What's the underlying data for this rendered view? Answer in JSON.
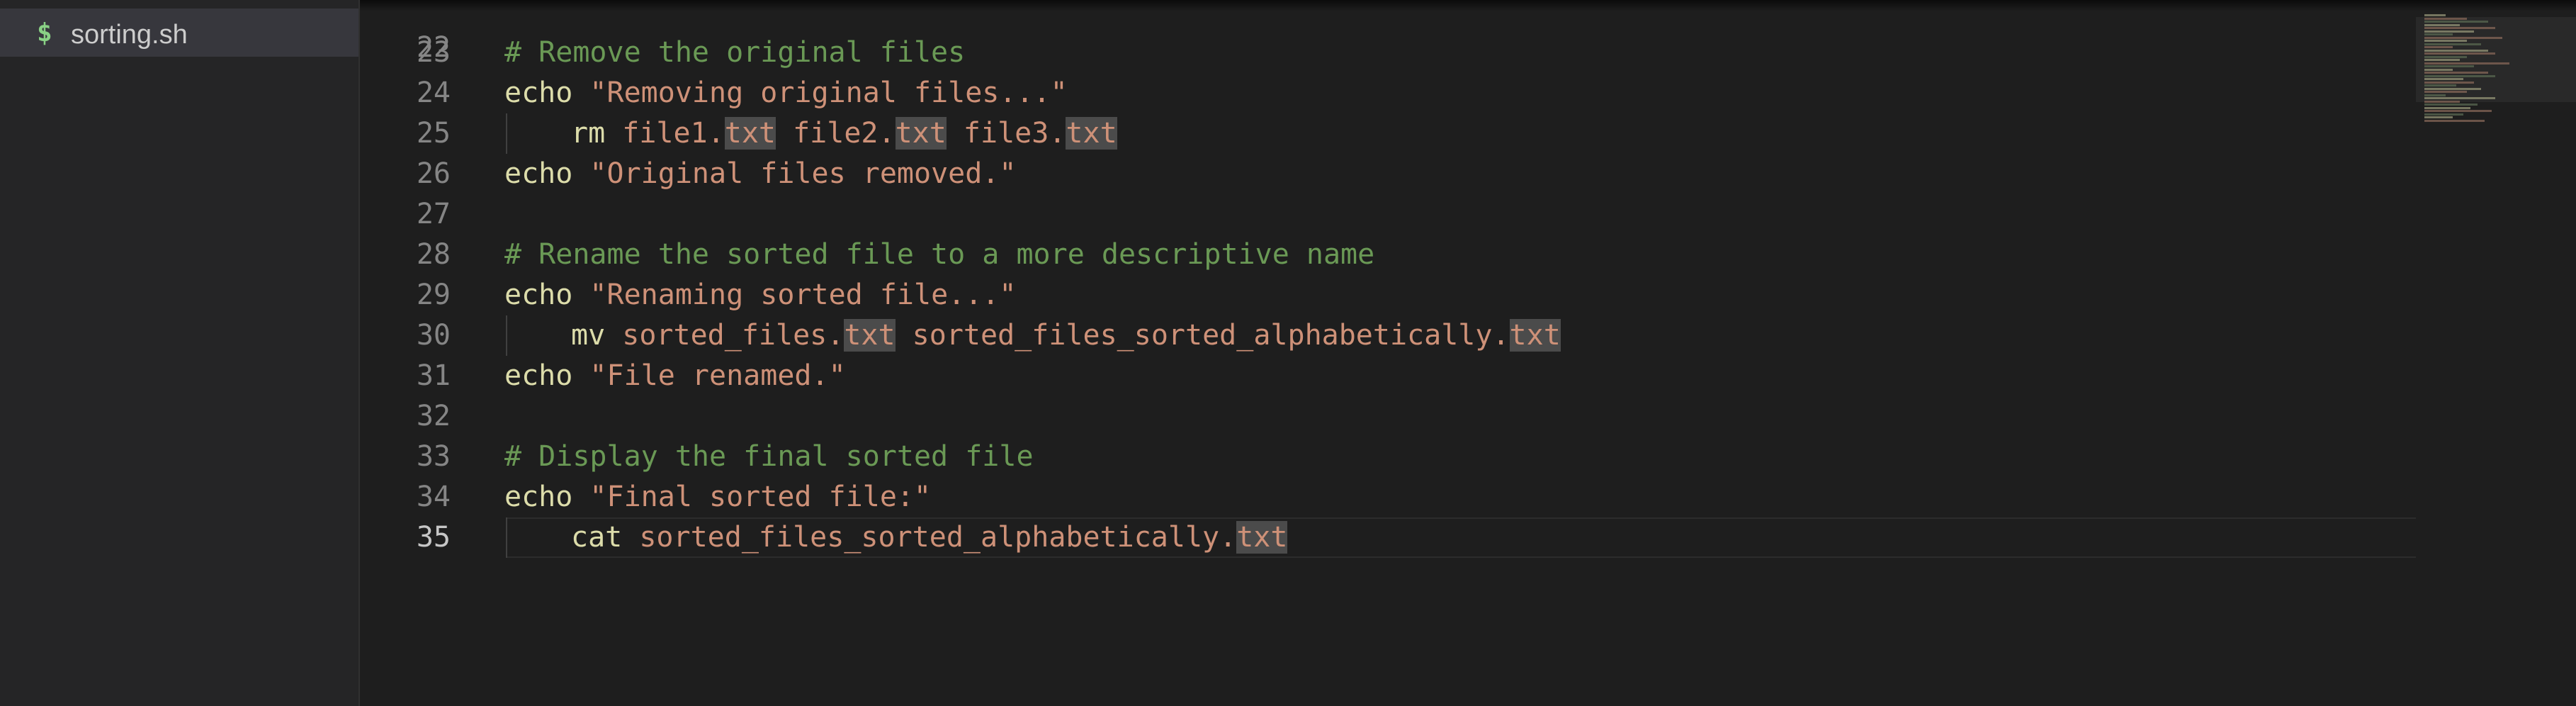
{
  "explorer": {
    "file": {
      "icon": "$",
      "name": "sorting.sh"
    }
  },
  "editor": {
    "partial_top_line": "22",
    "lines": [
      {
        "num": "23",
        "tokens": [
          {
            "t": "# Remove the original files",
            "c": "comment"
          }
        ]
      },
      {
        "num": "24",
        "tokens": [
          {
            "t": "echo",
            "c": "cmd"
          },
          {
            "t": " ",
            "c": "plain"
          },
          {
            "t": "\"Removing original files...\"",
            "c": "str"
          }
        ]
      },
      {
        "num": "25",
        "indent": true,
        "tokens": [
          {
            "t": "rm",
            "c": "cmd"
          },
          {
            "t": " ",
            "c": "plain"
          },
          {
            "t": "file1.",
            "c": "str"
          },
          {
            "t": "txt",
            "c": "hl"
          },
          {
            "t": " file2.",
            "c": "str"
          },
          {
            "t": "txt",
            "c": "hl"
          },
          {
            "t": " file3.",
            "c": "str"
          },
          {
            "t": "txt",
            "c": "hl"
          }
        ]
      },
      {
        "num": "26",
        "tokens": [
          {
            "t": "echo",
            "c": "cmd"
          },
          {
            "t": " ",
            "c": "plain"
          },
          {
            "t": "\"Original files removed.\"",
            "c": "str"
          }
        ]
      },
      {
        "num": "27",
        "tokens": []
      },
      {
        "num": "28",
        "tokens": [
          {
            "t": "# Rename the sorted file to a more descriptive name",
            "c": "comment"
          }
        ]
      },
      {
        "num": "29",
        "tokens": [
          {
            "t": "echo",
            "c": "cmd"
          },
          {
            "t": " ",
            "c": "plain"
          },
          {
            "t": "\"Renaming sorted file...\"",
            "c": "str"
          }
        ]
      },
      {
        "num": "30",
        "indent": true,
        "tokens": [
          {
            "t": "mv",
            "c": "cmd"
          },
          {
            "t": " ",
            "c": "plain"
          },
          {
            "t": "sorted_files.",
            "c": "str"
          },
          {
            "t": "txt",
            "c": "hl"
          },
          {
            "t": " sorted_files_sorted_alphabetically.",
            "c": "str"
          },
          {
            "t": "txt",
            "c": "hl"
          }
        ]
      },
      {
        "num": "31",
        "tokens": [
          {
            "t": "echo",
            "c": "cmd"
          },
          {
            "t": " ",
            "c": "plain"
          },
          {
            "t": "\"File renamed.\"",
            "c": "str"
          }
        ]
      },
      {
        "num": "32",
        "tokens": []
      },
      {
        "num": "33",
        "tokens": [
          {
            "t": "# Display the final sorted file",
            "c": "comment"
          }
        ]
      },
      {
        "num": "34",
        "tokens": [
          {
            "t": "echo",
            "c": "cmd"
          },
          {
            "t": " ",
            "c": "plain"
          },
          {
            "t": "\"Final sorted file:\"",
            "c": "str"
          }
        ]
      },
      {
        "num": "35",
        "indent": true,
        "active": true,
        "tokens": [
          {
            "t": "cat",
            "c": "cmd"
          },
          {
            "t": " ",
            "c": "plain"
          },
          {
            "t": "sorted_files_sorted_alphabetically.",
            "c": "str"
          },
          {
            "t": "txt",
            "c": "hl"
          }
        ]
      }
    ]
  },
  "colors": {
    "comment": "#6a9955",
    "command": "#dcdcaa",
    "string": "#ce9178",
    "highlight_bg": "#4b4b4b",
    "file_icon": "#89d185"
  }
}
